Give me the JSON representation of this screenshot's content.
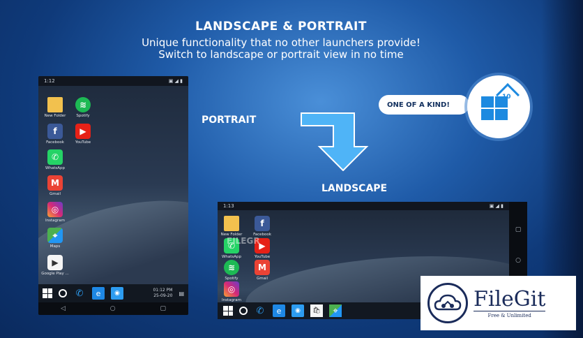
{
  "header": {
    "title": "LANDSCAPE & PORTRAIT",
    "subtitle_line1": "Unique functionality that no other launchers provide!",
    "subtitle_line2": "Switch to landscape or portrait view in no time"
  },
  "labels": {
    "portrait": "PORTRAIT",
    "landscape": "LANDSCAPE"
  },
  "badge": {
    "text": "ONE OF A KIND!",
    "logo_number": "10"
  },
  "portrait_phone": {
    "status_time": "1:12",
    "status_right": "▣ ◢ ▮",
    "apps": [
      {
        "label": "New Folder",
        "icon": "folder-icon",
        "glyph": ""
      },
      {
        "label": "Spotify",
        "icon": "spotify-icon",
        "glyph": "≋"
      },
      {
        "label": "Facebook",
        "icon": "facebook-icon",
        "glyph": "f"
      },
      {
        "label": "YouTube",
        "icon": "youtube-icon",
        "glyph": "▶"
      },
      {
        "label": "WhatsApp",
        "icon": "whatsapp-icon",
        "glyph": "✆"
      },
      {
        "label": "Gmail",
        "icon": "gmail-icon",
        "glyph": "M"
      },
      {
        "label": "Instagram",
        "icon": "instagram-icon",
        "glyph": "◎"
      },
      {
        "label": "Maps",
        "icon": "maps-icon",
        "glyph": "⌖"
      },
      {
        "label": "Google Play ...",
        "icon": "google-play-icon",
        "glyph": "▶"
      }
    ],
    "clock_time": "01:12 PM",
    "clock_date": "25-09-20",
    "nav": {
      "back": "◁",
      "home": "○",
      "recents": "▢"
    }
  },
  "landscape_phone": {
    "status_time": "1:13",
    "status_right": "▣ ◢ ▮",
    "apps": [
      {
        "label": "New Folder",
        "icon": "folder-icon",
        "glyph": ""
      },
      {
        "label": "Facebook",
        "icon": "facebook-icon",
        "glyph": "f"
      },
      {
        "label": "WhatsApp",
        "icon": "whatsapp-icon",
        "glyph": "✆"
      },
      {
        "label": "YouTube",
        "icon": "youtube-icon",
        "glyph": "▶"
      },
      {
        "label": "Spotify",
        "icon": "spotify-icon",
        "glyph": "≋"
      },
      {
        "label": "Gmail",
        "icon": "gmail-icon",
        "glyph": "M"
      },
      {
        "label": "Instagram",
        "icon": "instagram-icon",
        "glyph": "◎"
      }
    ],
    "nav": {
      "back": "◁",
      "home": "○",
      "recents": "▢"
    }
  },
  "taskbar_glyphs": {
    "phone": "✆",
    "edge": "e",
    "camera": "◉",
    "store": "🛍",
    "maps": "⌖",
    "notif": "▤"
  },
  "watermark": "FILEGR",
  "filegit": {
    "name": "FileGit",
    "tagline": "Free & Unlimited"
  },
  "colors": {
    "accent_blue": "#2d9cf0",
    "badge_text": "#12305e",
    "filegit_navy": "#1a2b5a"
  }
}
